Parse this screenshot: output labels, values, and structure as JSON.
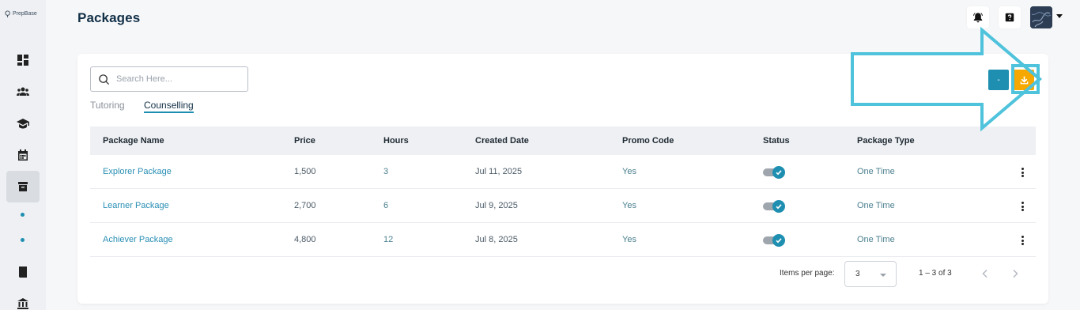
{
  "app": {
    "logo_text": "PrepBase"
  },
  "page": {
    "title": "Packages"
  },
  "search": {
    "placeholder": "Search Here..."
  },
  "tabs": [
    {
      "label": "Tutoring",
      "active": false
    },
    {
      "label": "Counselling",
      "active": true
    }
  ],
  "actions": {
    "teal_button_label": "-"
  },
  "table": {
    "columns": [
      "Package Name",
      "Price",
      "Hours",
      "Created Date",
      "Promo Code",
      "Status",
      "Package Type"
    ],
    "rows": [
      {
        "name": "Explorer Package",
        "price": "1,500",
        "hours": "3",
        "created": "Jul 11, 2025",
        "promo": "Yes",
        "status_on": true,
        "type": "One Time"
      },
      {
        "name": "Learner Package",
        "price": "2,700",
        "hours": "6",
        "created": "Jul 9, 2025",
        "promo": "Yes",
        "status_on": true,
        "type": "One Time"
      },
      {
        "name": "Achiever Package",
        "price": "4,800",
        "hours": "12",
        "created": "Jul 8, 2025",
        "promo": "Yes",
        "status_on": true,
        "type": "One Time"
      }
    ]
  },
  "paginator": {
    "items_per_page_label": "Items per page:",
    "items_per_page_value": "3",
    "range": "1 – 3 of 3"
  },
  "colors": {
    "accent": "#1e8fb0",
    "download": "#f7a800",
    "annotation": "#4fc3dc",
    "title": "#123047"
  },
  "icons": {
    "sidebar": [
      "dashboard-icon",
      "users-icon",
      "graduation-cap-icon",
      "calendar-icon",
      "package-icon",
      "dot",
      "dot",
      "book-icon",
      "bank-icon"
    ],
    "header": [
      "bell-icon",
      "help-icon"
    ]
  }
}
